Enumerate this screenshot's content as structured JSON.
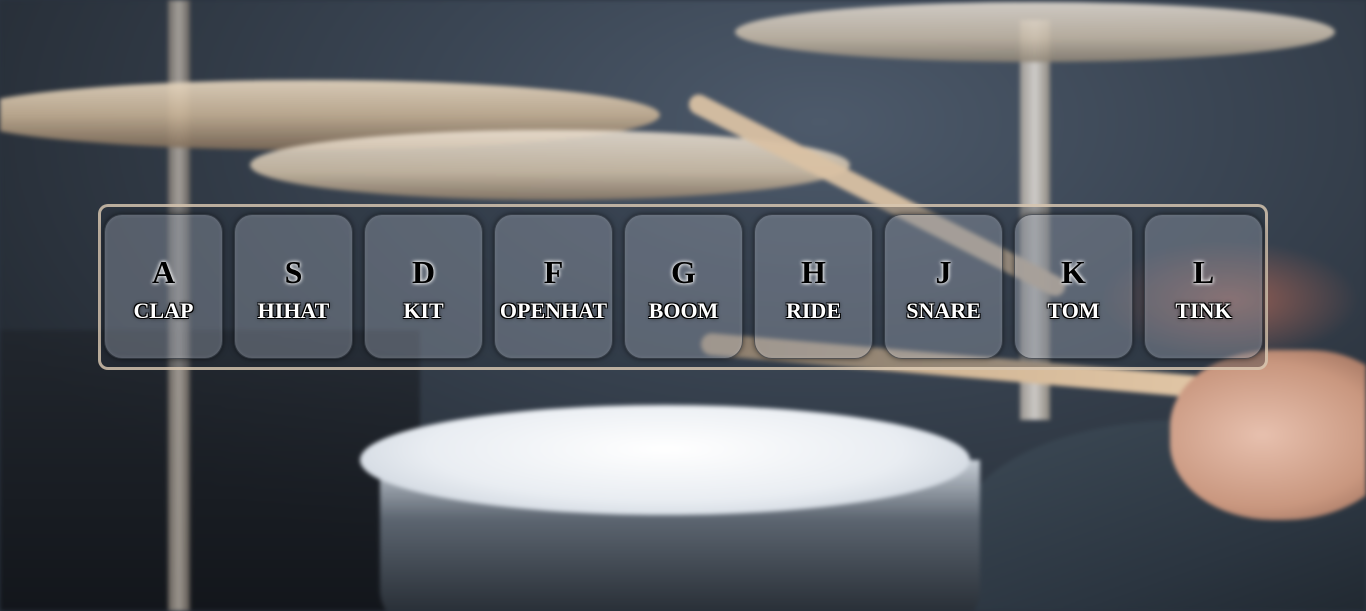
{
  "keys": [
    {
      "letter": "A",
      "sound": "CLAP"
    },
    {
      "letter": "S",
      "sound": "HIHAT"
    },
    {
      "letter": "D",
      "sound": "KIT"
    },
    {
      "letter": "F",
      "sound": "OPENHAT"
    },
    {
      "letter": "G",
      "sound": "BOOM"
    },
    {
      "letter": "H",
      "sound": "RIDE"
    },
    {
      "letter": "J",
      "sound": "SNARE"
    },
    {
      "letter": "K",
      "sound": "TOM"
    },
    {
      "letter": "L",
      "sound": "TINK"
    }
  ],
  "colors": {
    "panel_border": "#ebd7be",
    "letter_text": "#000000",
    "sound_text": "#ffffff"
  }
}
